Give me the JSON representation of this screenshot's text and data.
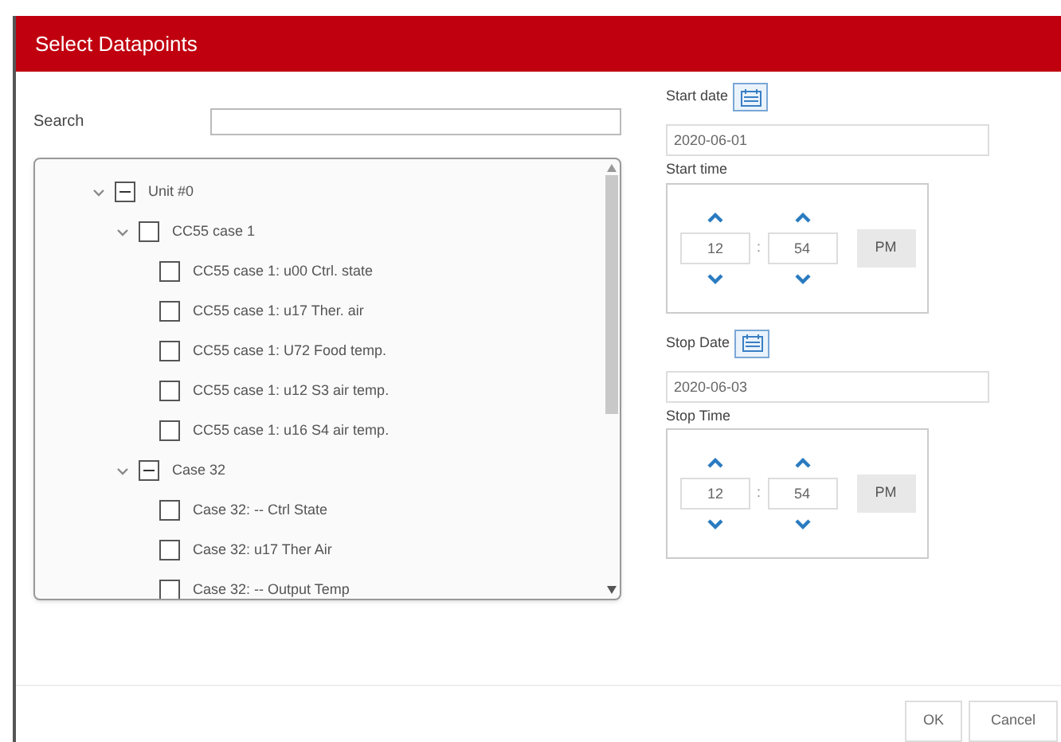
{
  "dialog": {
    "title": "Select Datapoints"
  },
  "search": {
    "label": "Search"
  },
  "tree": [
    {
      "label": "Unit #0",
      "expanded": true,
      "indeterminate": true,
      "children": [
        {
          "label": "CC55 case 1",
          "expanded": true,
          "checked": false,
          "indeterminate": false,
          "children": [
            {
              "label": "CC55 case 1: u00 Ctrl. state",
              "checked": false,
              "indeterminate": false
            },
            {
              "label": "CC55 case 1: u17 Ther. air",
              "checked": false,
              "indeterminate": false
            },
            {
              "label": "CC55 case 1: U72 Food temp.",
              "checked": false,
              "indeterminate": false
            },
            {
              "label": "CC55 case 1: u12 S3 air temp.",
              "checked": false,
              "indeterminate": false
            },
            {
              "label": "CC55 case 1: u16 S4 air temp.",
              "checked": false,
              "indeterminate": false
            }
          ]
        },
        {
          "label": "Case 32",
          "expanded": true,
          "indeterminate": true,
          "children": [
            {
              "label": "Case 32: -- Ctrl State",
              "checked": false,
              "indeterminate": false
            },
            {
              "label": "Case 32: u17 Ther Air",
              "checked": false,
              "indeterminate": false
            },
            {
              "label": "Case 32: -- Output Temp",
              "checked": false,
              "indeterminate": false
            }
          ]
        }
      ]
    }
  ],
  "ranges": [
    {
      "date_label": "Start date",
      "date": "2020-06-01",
      "time_label": "Start time",
      "hour": "12",
      "separator": ":",
      "minute": "54",
      "period": "PM"
    },
    {
      "date_label": "Stop Date",
      "date": "2020-06-03",
      "time_label": "Stop Time",
      "hour": "12",
      "separator": ":",
      "minute": "54",
      "period": "PM"
    }
  ],
  "buttons": [
    "OK",
    "Cancel"
  ]
}
